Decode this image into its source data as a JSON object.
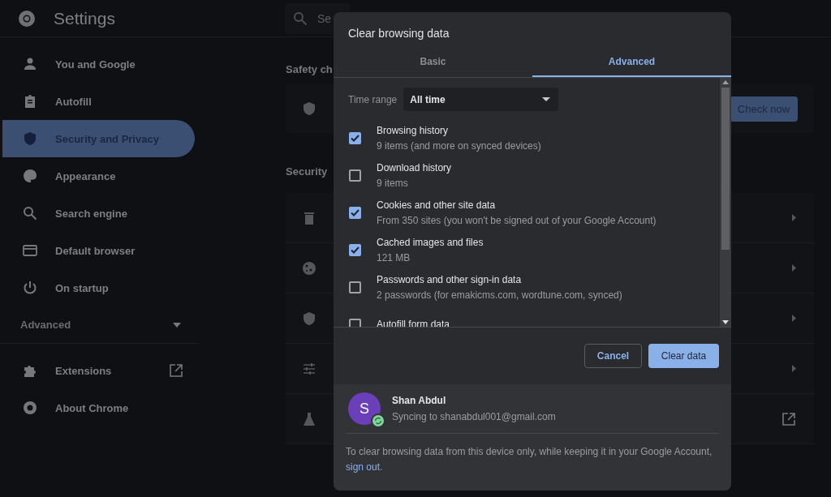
{
  "header": {
    "title": "Settings",
    "search": {
      "placeholder": "Se"
    }
  },
  "sidebar": {
    "items": [
      {
        "label": "You and Google",
        "selected": false
      },
      {
        "label": "Autofill",
        "selected": false
      },
      {
        "label": "Security and Privacy",
        "selected": true
      },
      {
        "label": "Appearance",
        "selected": false
      },
      {
        "label": "Search engine",
        "selected": false
      },
      {
        "label": "Default browser",
        "selected": false
      },
      {
        "label": "On startup",
        "selected": false
      }
    ],
    "advanced": {
      "label": "Advanced",
      "expanded": false
    },
    "footer_items": [
      {
        "label": "Extensions"
      },
      {
        "label": "About Chrome"
      }
    ]
  },
  "main": {
    "safety_heading": "Safety ch",
    "safety_card": {
      "button": "Check now"
    },
    "security_heading": "Security"
  },
  "dialog": {
    "title": "Clear browsing data",
    "tabs": [
      {
        "label": "Basic",
        "selected": false
      },
      {
        "label": "Advanced",
        "selected": true
      }
    ],
    "time_range": {
      "label": "Time range",
      "value": "All time"
    },
    "options": [
      {
        "title": "Browsing history",
        "detail": "9 items (and more on synced devices)",
        "checked": true
      },
      {
        "title": "Download history",
        "detail": "9 items",
        "checked": false
      },
      {
        "title": "Cookies and other site data",
        "detail": "From 350 sites (you won't be signed out of your Google Account)",
        "checked": true
      },
      {
        "title": "Cached images and files",
        "detail": "121 MB",
        "checked": true
      },
      {
        "title": "Passwords and other sign-in data",
        "detail": "2 passwords (for emakicms.com, wordtune.com, synced)",
        "checked": false
      },
      {
        "title": "Autofill form data",
        "checked": false
      }
    ],
    "buttons": {
      "cancel": "Cancel",
      "confirm": "Clear data"
    },
    "account": {
      "initial": "S",
      "name": "Shan Abdul",
      "status": "Syncing to shanabdul001@gmail.com",
      "syncing": true
    },
    "note": "To clear browsing data from this device only, while keeping it in your Google Account, ",
    "note_link": "sign out",
    "note_end": "."
  }
}
